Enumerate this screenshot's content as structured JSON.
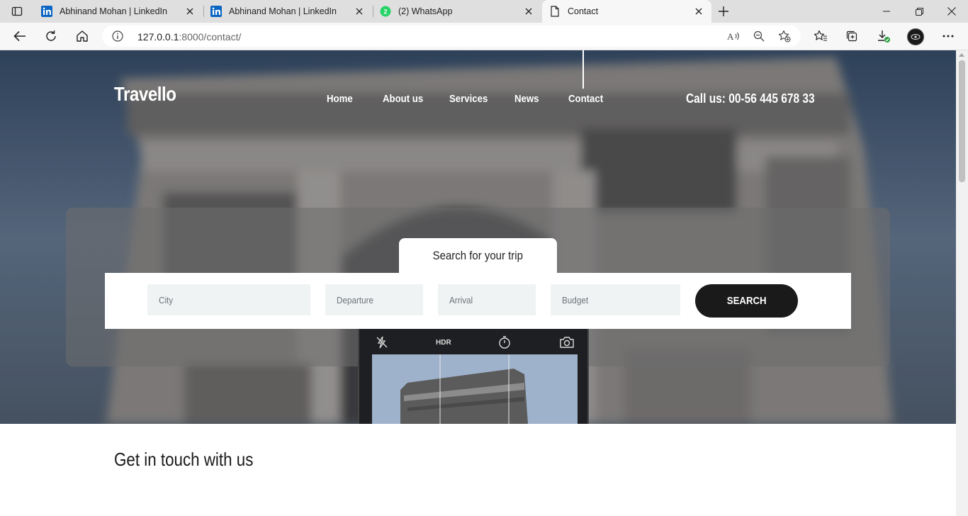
{
  "browser": {
    "tabs": [
      {
        "title": "Abhinand Mohan | LinkedIn",
        "icon": "linkedin-icon",
        "active": false
      },
      {
        "title": "Abhinand Mohan | LinkedIn",
        "icon": "linkedin-icon",
        "active": false
      },
      {
        "title": "(2) WhatsApp",
        "icon": "whatsapp-icon",
        "badge": "2",
        "active": false
      },
      {
        "title": "Contact",
        "icon": "page-icon",
        "active": true
      }
    ],
    "address": {
      "host": "127.0.0.1",
      "rest": ":8000/contact/"
    }
  },
  "site": {
    "logo": "Travello",
    "nav": [
      "Home",
      "About us",
      "Services",
      "News",
      "Contact"
    ],
    "active_nav": "Contact",
    "phone": "Call us: 00-56 445 678 33"
  },
  "search": {
    "tab_label": "Search for your trip",
    "fields": [
      {
        "placeholder": "City"
      },
      {
        "placeholder": "Departure"
      },
      {
        "placeholder": "Arrival"
      },
      {
        "placeholder": "Budget"
      }
    ],
    "button": "SEARCH"
  },
  "camera": {
    "hdr": "HDR"
  },
  "contact": {
    "title": "Get in touch with us"
  },
  "colors": {
    "search_button": "#1a1a1a",
    "field_bg": "#f0f3f4",
    "tab_bar": "#dfdfdf"
  }
}
